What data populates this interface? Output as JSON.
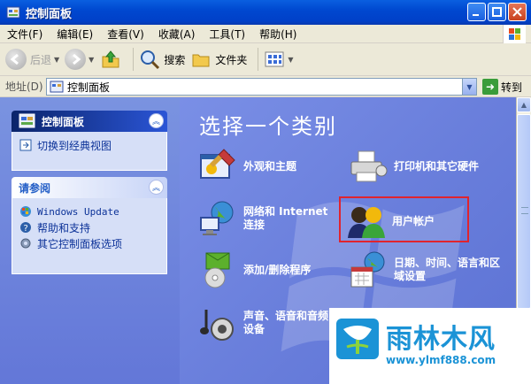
{
  "window": {
    "title": "控制面板"
  },
  "menu": [
    "文件(F)",
    "编辑(E)",
    "查看(V)",
    "收藏(A)",
    "工具(T)",
    "帮助(H)"
  ],
  "toolbar": {
    "back": "后退",
    "search": "搜索",
    "folders": "文件夹"
  },
  "address": {
    "label": "地址(D)",
    "value": "控制面板",
    "go": "转到"
  },
  "sidebar": {
    "panel1": {
      "title": "控制面板",
      "links": [
        "切换到经典视图"
      ]
    },
    "panel2": {
      "title": "请参阅",
      "links": [
        "Windows Update",
        "帮助和支持",
        "其它控制面板选项"
      ]
    }
  },
  "main": {
    "heading": "选择一个类别",
    "categories": [
      {
        "label": "外观和主题",
        "icon": "appearance-icon"
      },
      {
        "label": "打印机和其它硬件",
        "icon": "printer-icon"
      },
      {
        "label": "网络和 Internet 连接",
        "icon": "network-globe-icon"
      },
      {
        "label": "用户帐户",
        "icon": "user-accounts-icon"
      },
      {
        "label": "添加/删除程序",
        "icon": "add-remove-programs-icon"
      },
      {
        "label": "日期、时间、语言和区域设置",
        "icon": "date-time-region-icon"
      },
      {
        "label": "声音、语音和音频设备",
        "icon": "sound-icon"
      }
    ]
  },
  "branding": {
    "name": "雨林木风",
    "url": "www.ylmf888.com"
  },
  "colors": {
    "titlebar": "#0048d0",
    "pane": "#6a7fdc",
    "highlight": "#e0242e",
    "brand": "#1b93d6"
  }
}
